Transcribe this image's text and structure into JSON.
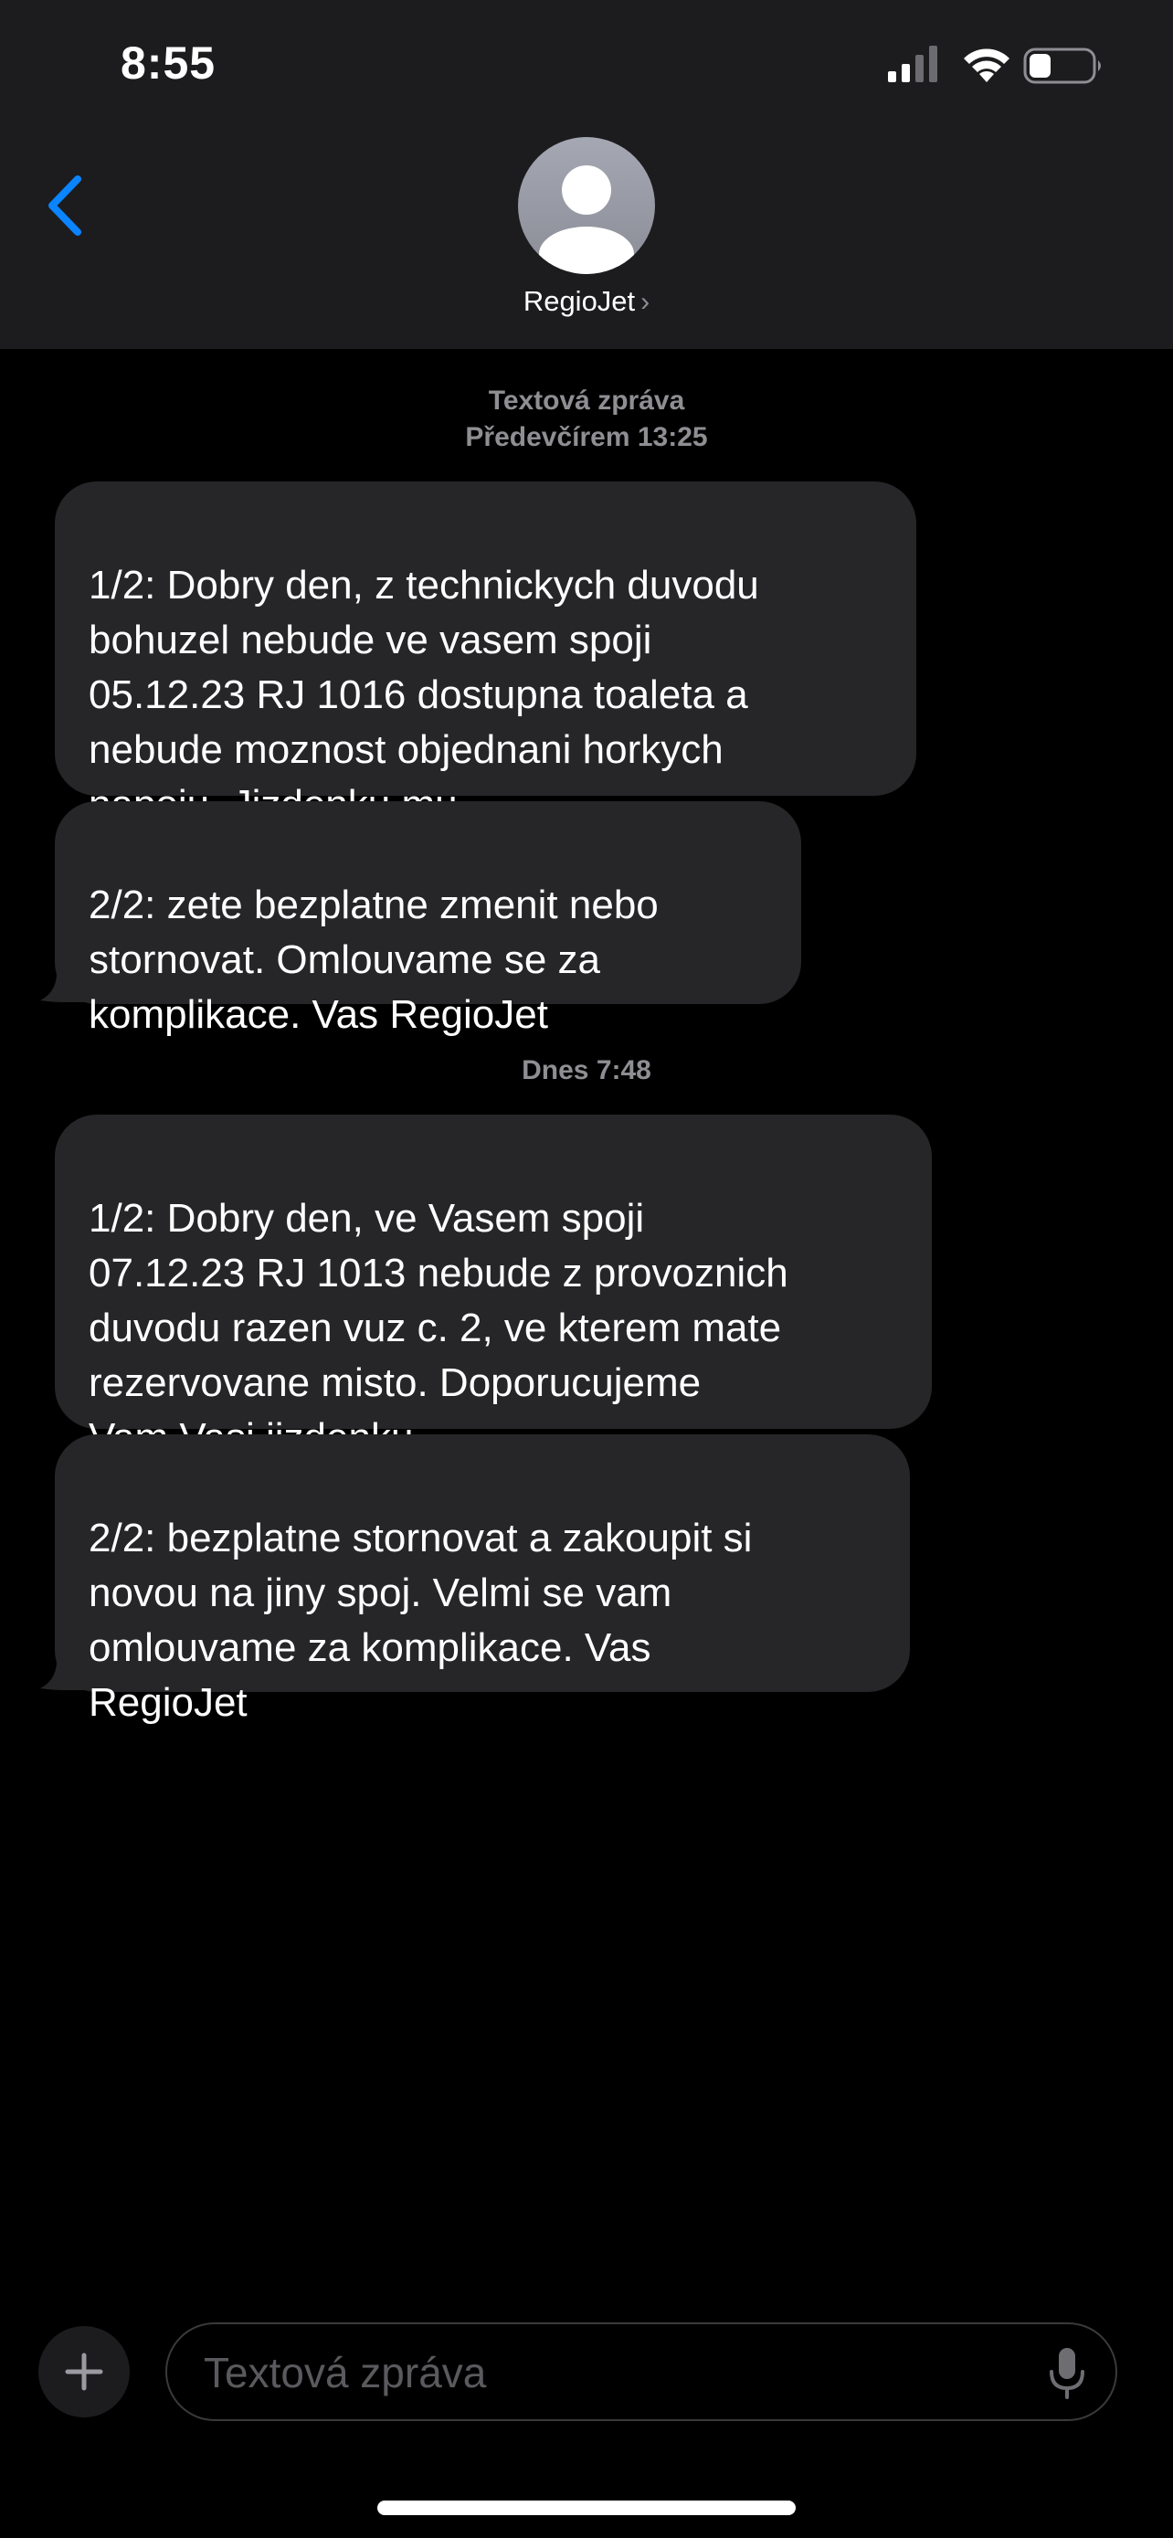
{
  "status_bar": {
    "time": "8:55",
    "signal_bars": 4,
    "signal_bars_active": 2,
    "battery_level": 0.35
  },
  "header": {
    "back_icon": "chevron-left-icon",
    "avatar_icon": "person-silhouette-icon",
    "contact_name": "RegioJet",
    "contact_chevron": "›"
  },
  "conversation": {
    "group1": {
      "label": "Textová zpráva",
      "date": "Předevčírem 13:25",
      "messages": [
        "1/2: Dobry den, z technickych duvodu\nbohuzel nebude ve vasem spoji\n05.12.23 RJ 1016 dostupna toaleta a\nnebude moznost objednani horkych\nnapoju. Jizdenku mu",
        "2/2: zete bezplatne zmenit nebo\nstornovat. Omlouvame se za\nkomplikace. Vas RegioJet"
      ]
    },
    "group2": {
      "date": "Dnes 7:48",
      "messages": [
        "1/2: Dobry den, ve Vasem spoji\n07.12.23 RJ 1013 nebude z provoznich\nduvodu razen vuz c. 2, ve kterem mate\nrezervovane misto. Doporucujeme\nVam Vasi jizdenku",
        "2/2: bezplatne stornovat a zakoupit si\nnovou na jiny spoj. Velmi se vam\nomlouvame za komplikace. Vas\nRegioJet"
      ]
    }
  },
  "input_bar": {
    "plus_icon": "plus-icon",
    "placeholder": "Textová zpráva",
    "value": "",
    "mic_icon": "microphone-icon"
  },
  "colors": {
    "accent": "#0a84ff",
    "header_bg": "#1c1c1e",
    "bubble_incoming": "#262628",
    "timestamp": "#8e8e93",
    "background": "#000000"
  }
}
